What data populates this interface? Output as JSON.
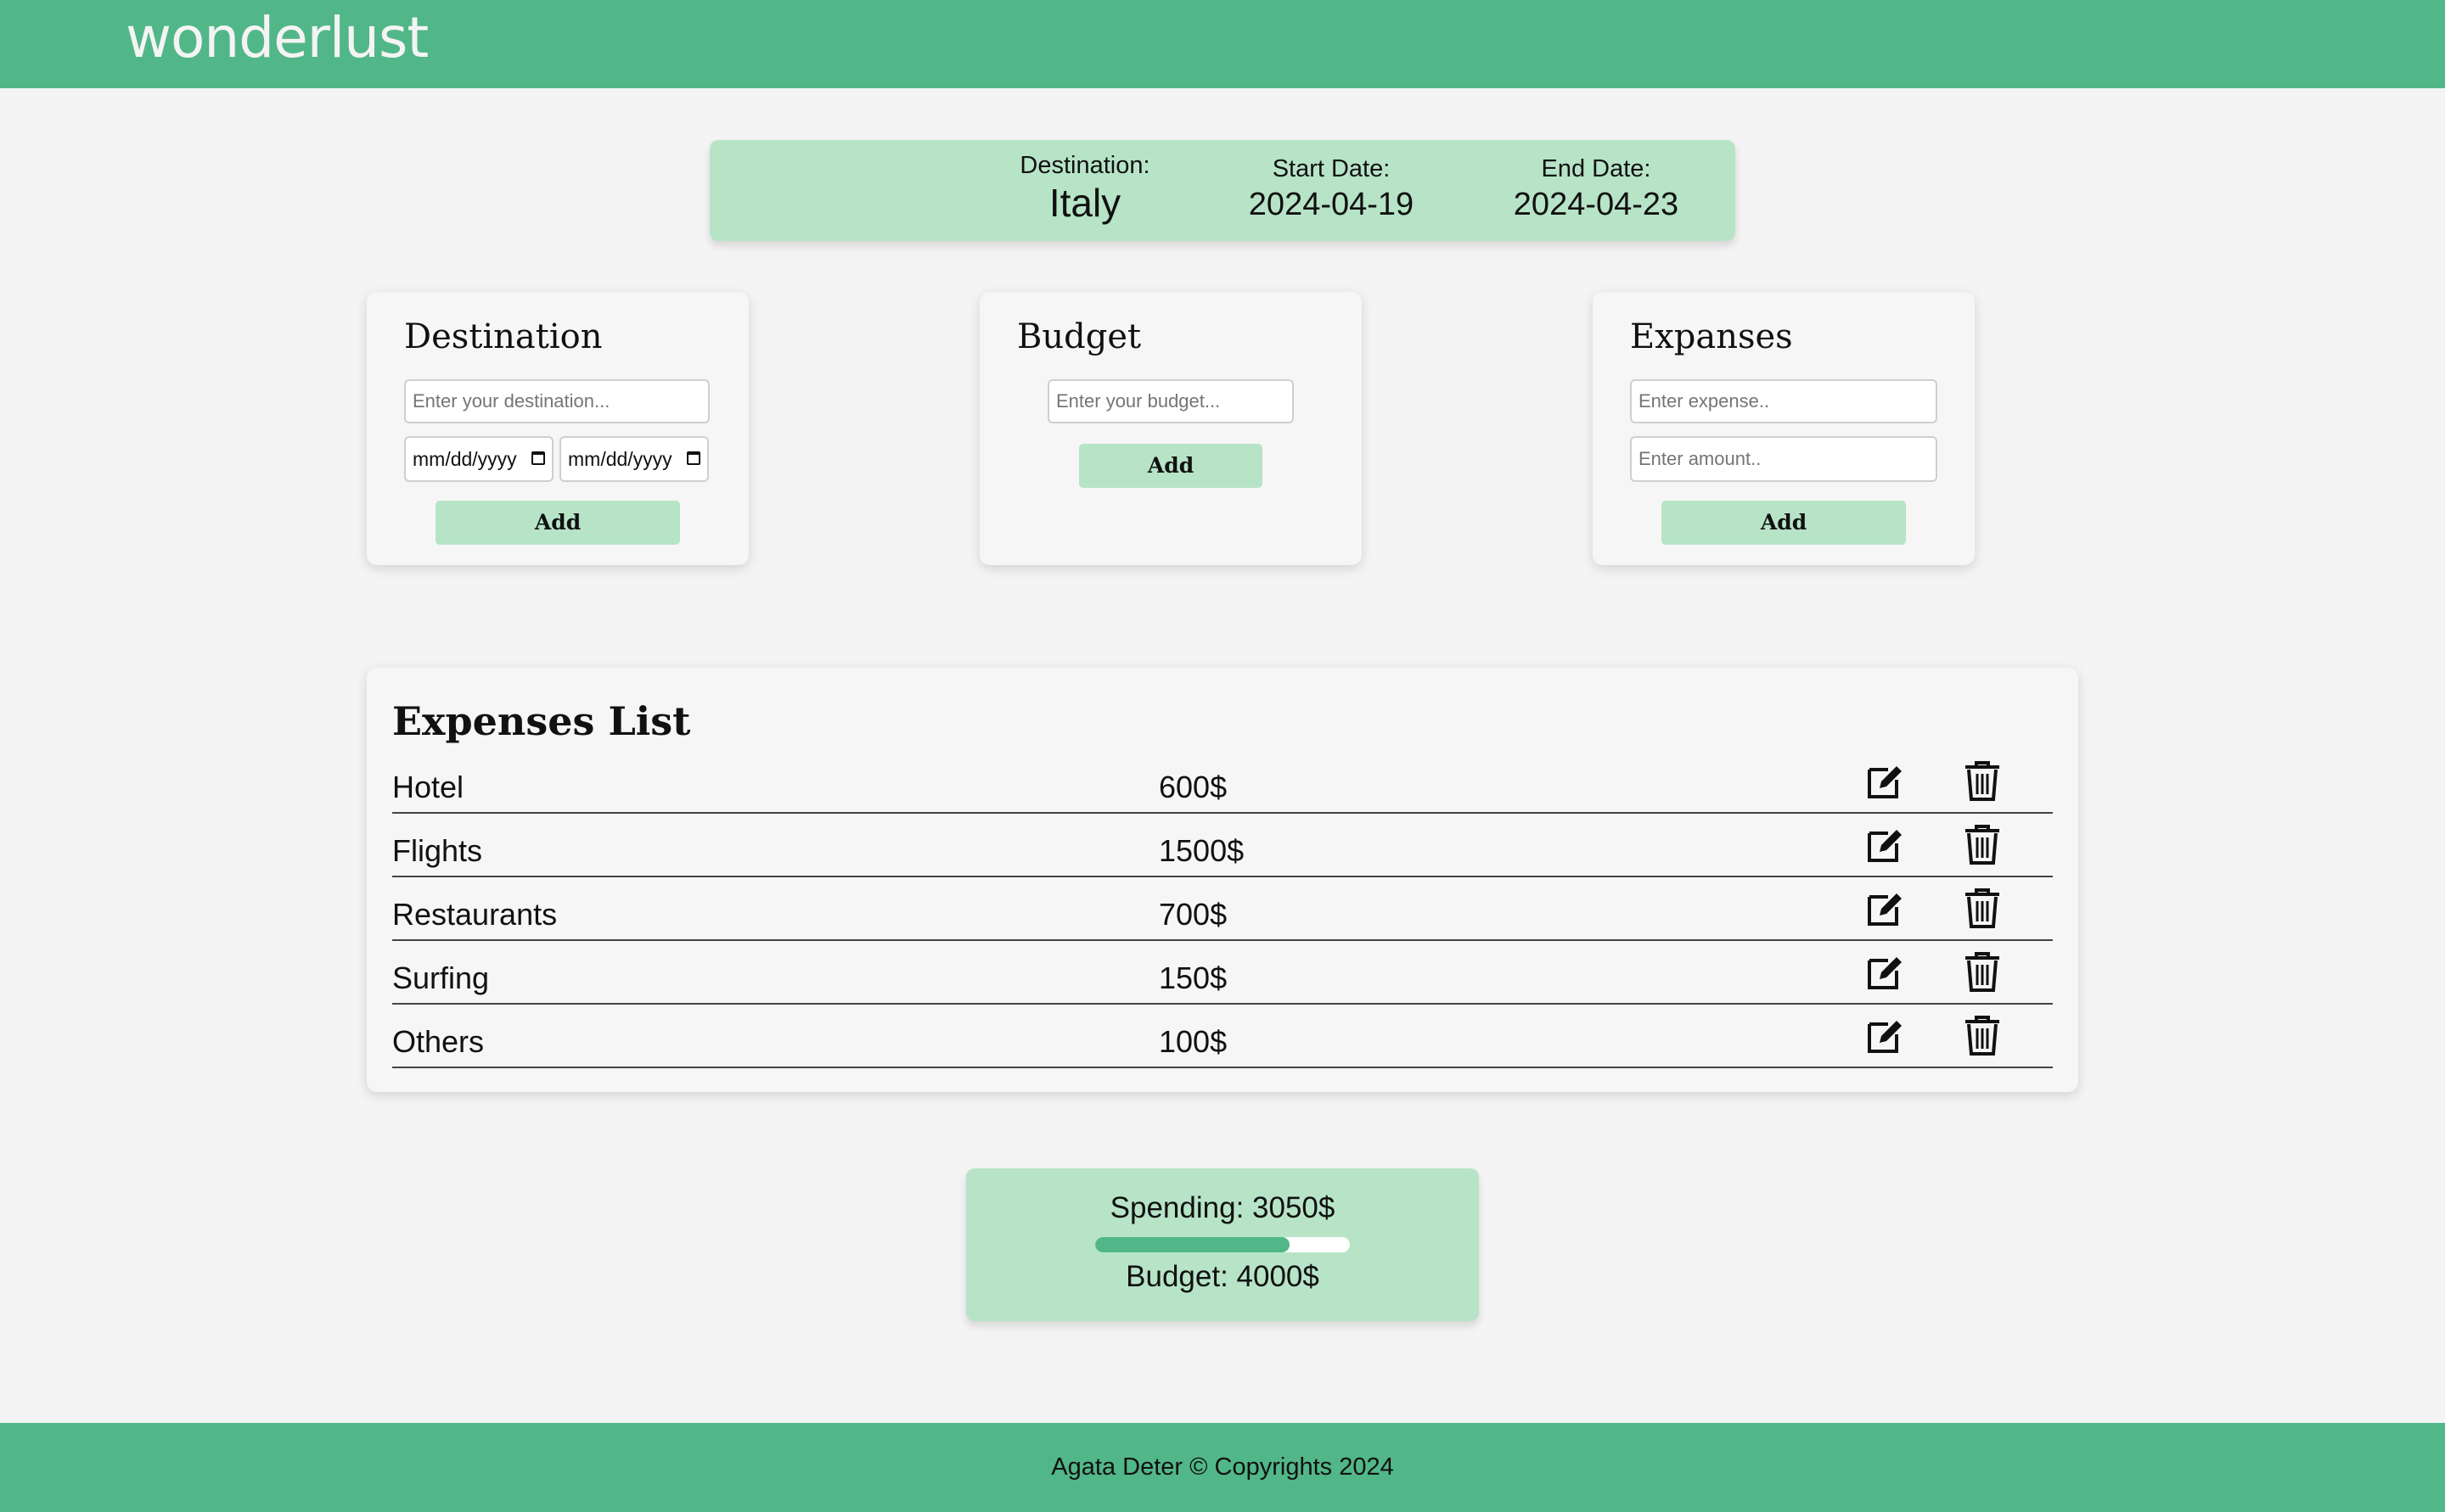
{
  "header": {
    "logo": "wonderlust"
  },
  "trip": {
    "destination_label": "Destination:",
    "destination": "Italy",
    "start_label": "Start Date:",
    "start_date": "2024-04-19",
    "end_label": "End Date:",
    "end_date": "2024-04-23"
  },
  "destination_card": {
    "title": "Destination",
    "input_placeholder": "Enter your destination...",
    "start_date_value": "mm/dd/yyyy",
    "end_date_value": "mm/dd/yyyy",
    "add_label": "Add"
  },
  "budget_card": {
    "title": "Budget",
    "input_placeholder": "Enter your budget...",
    "add_label": "Add"
  },
  "expenses_card": {
    "title": "Expanses",
    "expense_placeholder": "Enter expense..",
    "amount_placeholder": "Enter amount..",
    "add_label": "Add"
  },
  "expenses_list": {
    "title": "Expenses List",
    "items": [
      {
        "name": "Hotel",
        "amount": "600$"
      },
      {
        "name": "Flights",
        "amount": "1500$"
      },
      {
        "name": "Restaurants",
        "amount": "700$"
      },
      {
        "name": "Surfing",
        "amount": "150$"
      },
      {
        "name": "Others",
        "amount": "100$"
      }
    ],
    "icons": {
      "edit": "edit-icon",
      "delete": "trash-icon"
    }
  },
  "summary": {
    "spending": "Spending: 3050$",
    "budget": "Budget: 4000$",
    "progress_fraction": 0.7625
  },
  "footer": {
    "text": "Agata Deter © Copyrights 2024"
  },
  "colors": {
    "primary": "#52b788",
    "light": "#b7e4c7",
    "background": "#f4f4f4"
  }
}
